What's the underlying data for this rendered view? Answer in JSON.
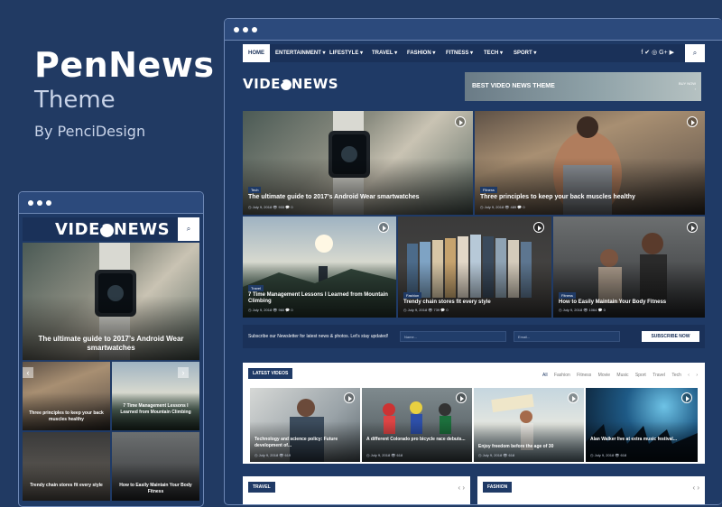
{
  "promo": {
    "title": "PenNews",
    "subtitle": "Theme",
    "byline": "By PenciDesign"
  },
  "desktop": {
    "nav": {
      "items": [
        "HOME",
        "ENTERTAINMENT ▾",
        "LIFESTYLE ▾",
        "TRAVEL ▾",
        "FASHION ▾",
        "FITNESS ▾",
        "TECH ▾",
        "SPORT ▾"
      ],
      "social": "f ✔ ◎ G+ ▶",
      "search_icon": "⌕"
    },
    "logo": {
      "part1": "VIDE",
      "part2": "NEWS"
    },
    "banner": {
      "title": "BEST VIDEO NEWS THEME",
      "button": "BUY NOW",
      "button_arrow": "›"
    },
    "hero": [
      {
        "tag": "Tech",
        "title": "The ultimate guide to 2017’s Android Wear smartwatches",
        "meta": "◷ July 9, 2018   👁 933   💬 0"
      },
      {
        "tag": "Fitness",
        "title": "Three principles to keep your back muscles healthy",
        "meta": "◷ July 9, 2018   👁 489   💬 0"
      }
    ],
    "grid": [
      {
        "tag": "Travel",
        "title": "7 Time Management Lessons I Learned from Mountain Climbing",
        "meta": "◷ July 9, 2018   👁 960   💬 0"
      },
      {
        "tag": "Fashion",
        "title": "Trendy chain stores fit every style",
        "meta": "◷ July 9, 2018   👁 739   💬 0"
      },
      {
        "tag": "Fitness",
        "title": "How to Easily Maintain Your Body Fitness",
        "meta": "◷ July 9, 2018   👁 1064   💬 0"
      }
    ],
    "newsletter": {
      "text": "Subscribe our Newsletter for latest news & photos. Let's stay updated!",
      "name_placeholder": "Name...",
      "email_placeholder": "Email...",
      "button": "SUBSCRIBE NOW"
    },
    "latest": {
      "header": "LATEST VIDEOS",
      "tabs": [
        "All",
        "Fashion",
        "Fitness",
        "Movie",
        "Music",
        "Sport",
        "Travel",
        "Tech",
        "‹",
        "›"
      ],
      "items": [
        {
          "title": "Technology and science policy: Future development of...",
          "meta": "◷ July 9, 2018   👁 619"
        },
        {
          "title": "A different Colorado pro bicycle race debuts...",
          "meta": "◷ July 9, 2018   👁 618"
        },
        {
          "title": "Enjoy freedom before the age of 30",
          "meta": "◷ July 9, 2018   👁 618"
        },
        {
          "title": "Alan Walker live at extra music festival...",
          "meta": "◷ July 9, 2018   👁 618"
        }
      ]
    },
    "bottom_sections": [
      {
        "header": "TRAVEL",
        "arrows": "‹  ›"
      },
      {
        "header": "FASHION",
        "arrows": "‹  ›"
      }
    ]
  },
  "mobile": {
    "logo": {
      "part1": "VIDE",
      "part2": "NEWS"
    },
    "search_icon": "⌕",
    "hero": {
      "title": "The ultimate guide to 2017’s Android Wear smartwatches"
    },
    "grid": [
      {
        "title": "Three principles to keep your back muscles healthy"
      },
      {
        "title": "7 Time Management Lessons I Learned from Mountain Climbing"
      },
      {
        "title": "Trendy chain stores fit every style"
      },
      {
        "title": "How to Easily Maintain Your Body Fitness"
      }
    ],
    "arrows": {
      "prev": "‹",
      "next": "›"
    }
  },
  "colors": {
    "background": "#213a63",
    "window": "#1f3a66",
    "nav": "#1a3159"
  }
}
